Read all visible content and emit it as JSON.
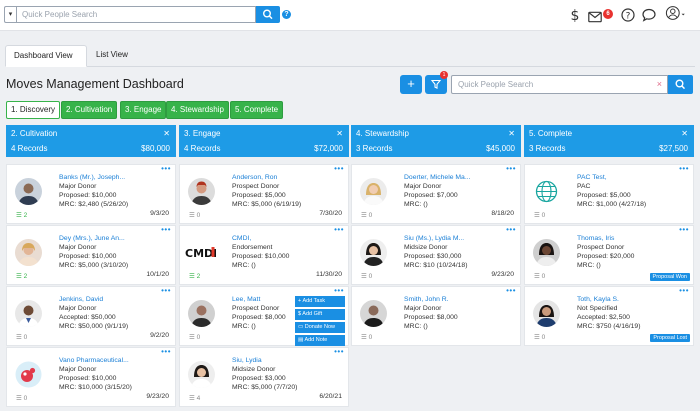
{
  "header": {
    "search_placeholder": "Quick People Search",
    "mail_count": "6",
    "help_glyph": "?"
  },
  "tabs": [
    "Dashboard View",
    "List View"
  ],
  "dashboard": {
    "title": "Moves Management Dashboard",
    "search_placeholder": "Quick People Search",
    "filter_count": "1",
    "add_glyph": "+",
    "clear_glyph": "×"
  },
  "stages": [
    "1. Discovery",
    "2. Cultivation",
    "3. Engage",
    "4. Stewardship",
    "5. Complete"
  ],
  "columns": [
    {
      "title": "2. Cultivation",
      "records": "4 Records",
      "total": "$80,000",
      "cards": [
        {
          "name": "Banks (Mr.), Joseph...",
          "type": "Major Donor",
          "amount": "Proposed: $10,000",
          "mrc": "MRC: $2,480 (5/26/20)",
          "date": "9/3/20",
          "tasks": "2"
        },
        {
          "name": "Dey (Mrs.), June An...",
          "type": "Major Donor",
          "amount": "Proposed: $10,000",
          "mrc": "MRC: $5,000 (3/10/20)",
          "date": "10/1/20",
          "tasks": "2"
        },
        {
          "name": "Jenkins, David",
          "type": "Major Donor",
          "amount": "Accepted: $50,000",
          "mrc": "MRC: $50,000 (9/1/19)",
          "date": "9/2/20",
          "tasks": "0"
        },
        {
          "name": "Vano Pharmaceutical...",
          "type": "Major Donor",
          "amount": "Proposed: $10,000",
          "mrc": "MRC: $10,000 (3/15/20)",
          "date": "9/23/20",
          "tasks": "0"
        }
      ]
    },
    {
      "title": "3. Engage",
      "records": "4 Records",
      "total": "$72,000",
      "cards": [
        {
          "name": "Anderson, Ron",
          "type": "Prospect Donor",
          "amount": "Proposed: $5,000",
          "mrc": "MRC: $5,000 (6/19/19)",
          "date": "7/30/20",
          "tasks": "0"
        },
        {
          "name": "CMDI,",
          "type": "Endorsement",
          "amount": "Proposed: $10,000",
          "mrc": "MRC: ()",
          "date": "11/30/20",
          "tasks": "2"
        },
        {
          "name": "Lee, Matt",
          "type": "Prospect Donor",
          "amount": "Proposed: $8,000",
          "mrc": "MRC: ()",
          "date": "",
          "tasks": "0"
        },
        {
          "name": "Siu, Lydia",
          "type": "Midsize Donor",
          "amount": "Proposed: $3,000",
          "mrc": "MRC: $5,000 (7/7/20)",
          "date": "6/20/21",
          "tasks": "4"
        }
      ],
      "menu": [
        "Add Task",
        "Add Gift",
        "Donate Now",
        "Add Note"
      ]
    },
    {
      "title": "4. Stewardship",
      "records": "3 Records",
      "total": "$45,000",
      "cards": [
        {
          "name": "Doerter, Michele Ma...",
          "type": "Major Donor",
          "amount": "Proposed: $7,000",
          "mrc": "MRC: ()",
          "date": "8/18/20",
          "tasks": "0"
        },
        {
          "name": "Siu (Ms.), Lydia M...",
          "type": "Midsize Donor",
          "amount": "Proposed: $30,000",
          "mrc": "MRC: $10 (10/24/18)",
          "date": "9/23/20",
          "tasks": "0"
        },
        {
          "name": "Smith, John R.",
          "type": "Major Donor",
          "amount": "Proposed: $8,000",
          "mrc": "MRC: ()",
          "date": "",
          "tasks": "0"
        }
      ]
    },
    {
      "title": "5. Complete",
      "records": "3 Records",
      "total": "$27,500",
      "cards": [
        {
          "name": "PAC Test,",
          "type": "PAC",
          "amount": "Proposed: $5,000",
          "mrc": "MRC: $1,000 (4/27/18)",
          "date": "",
          "tasks": "0",
          "tag": ""
        },
        {
          "name": "Thomas, Iris",
          "type": "Prospect Donor",
          "amount": "Proposed: $20,000",
          "mrc": "MRC: ()",
          "date": "",
          "tasks": "0",
          "tag": "Proposal Won"
        },
        {
          "name": "Toth, Kayla S.",
          "type": "Not Specified",
          "amount": "Accepted: $2,500",
          "mrc": "MRC: $750 (4/16/19)",
          "date": "",
          "tasks": "0",
          "tag": "Proposal Lost"
        }
      ]
    }
  ],
  "colors": {
    "accent": "#1a8fe3",
    "column_header": "#1e9be6",
    "stage_green": "#37b34a",
    "alert": "#e8322f"
  },
  "icons": [
    "dropdown-caret-icon",
    "search-icon",
    "help-icon",
    "dollar-icon",
    "mail-icon",
    "question-icon",
    "chat-icon",
    "user-icon",
    "filter-icon",
    "task-list-icon",
    "more-dots-icon"
  ]
}
